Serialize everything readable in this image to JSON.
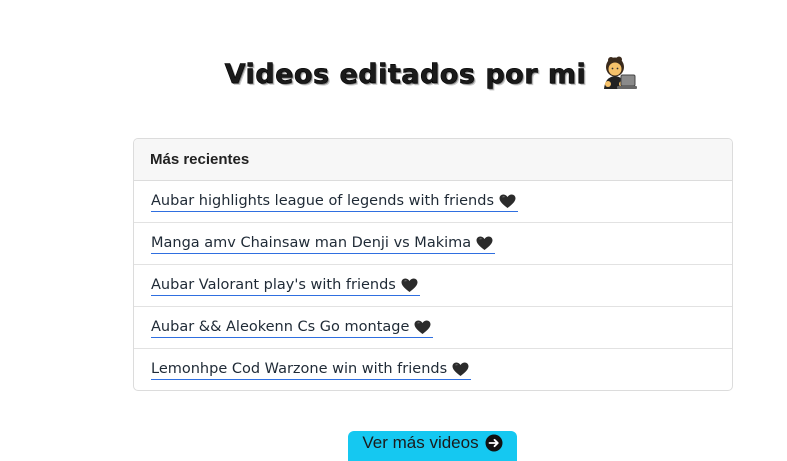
{
  "header": {
    "title": "Videos editados por mi",
    "title_icon": "person-at-computer-icon"
  },
  "card": {
    "header_label": "Más recientes",
    "items": [
      {
        "label": "Aubar highlights league of legends with friends",
        "icon": "black-heart-icon"
      },
      {
        "label": "Manga amv Chainsaw man Denji vs Makima",
        "icon": "black-heart-icon"
      },
      {
        "label": "Aubar Valorant play's with friends",
        "icon": "black-heart-icon"
      },
      {
        "label": "Aubar && Aleokenn Cs Go montage",
        "icon": "black-heart-icon"
      },
      {
        "label": "Lemonhpe Cod Warzone win with friends",
        "icon": "black-heart-icon"
      }
    ]
  },
  "cta": {
    "label": "Ver más videos",
    "icon": "arrow-right-circle-icon"
  },
  "colors": {
    "cta_background": "#15c8f1",
    "link_underline": "#2f6fe0",
    "card_header_bg": "#f7f7f7"
  }
}
